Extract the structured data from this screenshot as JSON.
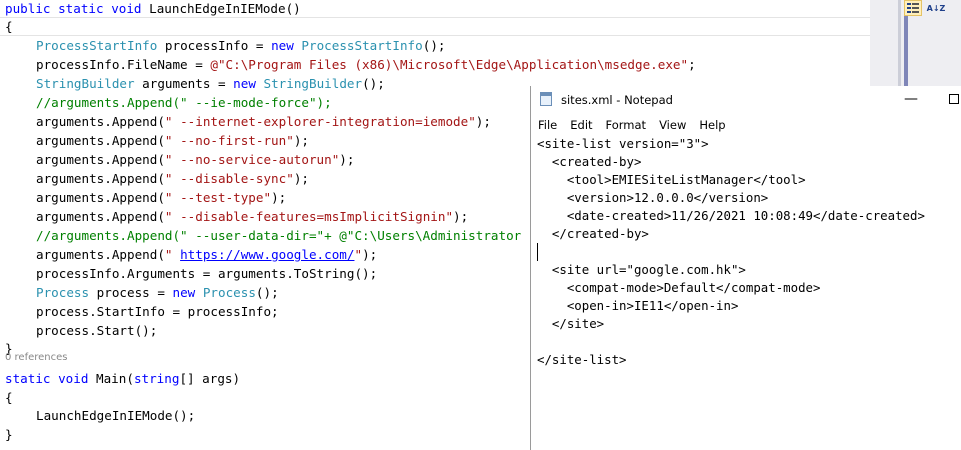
{
  "editor": {
    "code": {
      "l1": {
        "kw1": "public",
        "s1": " ",
        "kw2": "static",
        "s2": " ",
        "kw3": "void",
        "rest": " LaunchEdgeInIEMode()"
      },
      "l2": {
        "text": "{"
      },
      "l3": {
        "ty1": "ProcessStartInfo",
        "mid": " processInfo = ",
        "kw": "new",
        "s": " ",
        "ty2": "ProcessStartInfo",
        "end": "();"
      },
      "l4": {
        "pre": "processInfo.FileName = ",
        "str": "@\"C:\\Program Files (x86)\\Microsoft\\Edge\\Application\\msedge.exe\"",
        "end": ";"
      },
      "l5": {
        "ty1": "StringBuilder",
        "mid": " arguments = ",
        "kw": "new",
        "s": " ",
        "ty2": "StringBuilder",
        "end": "();"
      },
      "l6": {
        "comment": "//arguments.Append(\" --ie-mode-force\");"
      },
      "l7": {
        "pre": "arguments.Append(",
        "str": "\" --internet-explorer-integration=iemode\"",
        "end": ");"
      },
      "l8": {
        "pre": "arguments.Append(",
        "str": "\" --no-first-run\"",
        "end": ");"
      },
      "l9": {
        "pre": "arguments.Append(",
        "str": "\" --no-service-autorun\"",
        "end": ");"
      },
      "l10": {
        "pre": "arguments.Append(",
        "str": "\" --disable-sync\"",
        "end": ");"
      },
      "l11": {
        "pre": "arguments.Append(",
        "str": "\" --test-type\"",
        "end": ");"
      },
      "l12": {
        "pre": "arguments.Append(",
        "str": "\" --disable-features=msImplicitSignin\"",
        "end": ");"
      },
      "l13": {
        "comment": "//arguments.Append(\" --user-data-dir=\"+ @\"C:\\Users\\Administrator"
      },
      "l14": {
        "pre": "arguments.Append(",
        "q1": "\" ",
        "link": "https://www.google.com/",
        "q2": "\"",
        "end": ");"
      },
      "l15": {
        "text": "processInfo.Arguments = arguments.ToString();"
      },
      "l16": {
        "ty1": "Process",
        "mid": " process = ",
        "kw": "new",
        "s": " ",
        "ty2": "Process",
        "end": "();"
      },
      "l17": {
        "text": "process.StartInfo = processInfo;"
      },
      "l18": {
        "text": "process.Start();"
      },
      "l19": {
        "text": "}"
      },
      "codelens": "0 references",
      "l20": {
        "kw1": "static",
        "s1": " ",
        "kw2": "void",
        "mid": " Main(",
        "kw3": "string",
        "end": "[] args)"
      },
      "l21": {
        "text": "{"
      },
      "l22": {
        "text": "LaunchEdgeInIEMode();"
      },
      "l23": {
        "text": "}"
      }
    }
  },
  "toolbar": {
    "categorized_icon": "categorized-icon",
    "az_label": "A↓Z"
  },
  "notepad": {
    "title": "sites.xml - Notepad",
    "minimize_glyph": "—",
    "menu": [
      "File",
      "Edit",
      "Format",
      "View",
      "Help"
    ],
    "lines": [
      "<site-list version=\"3\">",
      "  <created-by>",
      "    <tool>EMIESiteListManager</tool>",
      "    <version>12.0.0.0</version>",
      "    <date-created>11/26/2021 10:08:49</date-created>",
      "  </created-by>",
      "",
      "  <site url=\"google.com.hk\">",
      "    <compat-mode>Default</compat-mode>",
      "    <open-in>IE11</open-in>",
      "  </site>",
      "",
      "</site-list>"
    ]
  },
  "colors": {
    "keyword": "#0000ff",
    "type": "#2b91af",
    "string": "#a31515",
    "comment": "#008000"
  }
}
